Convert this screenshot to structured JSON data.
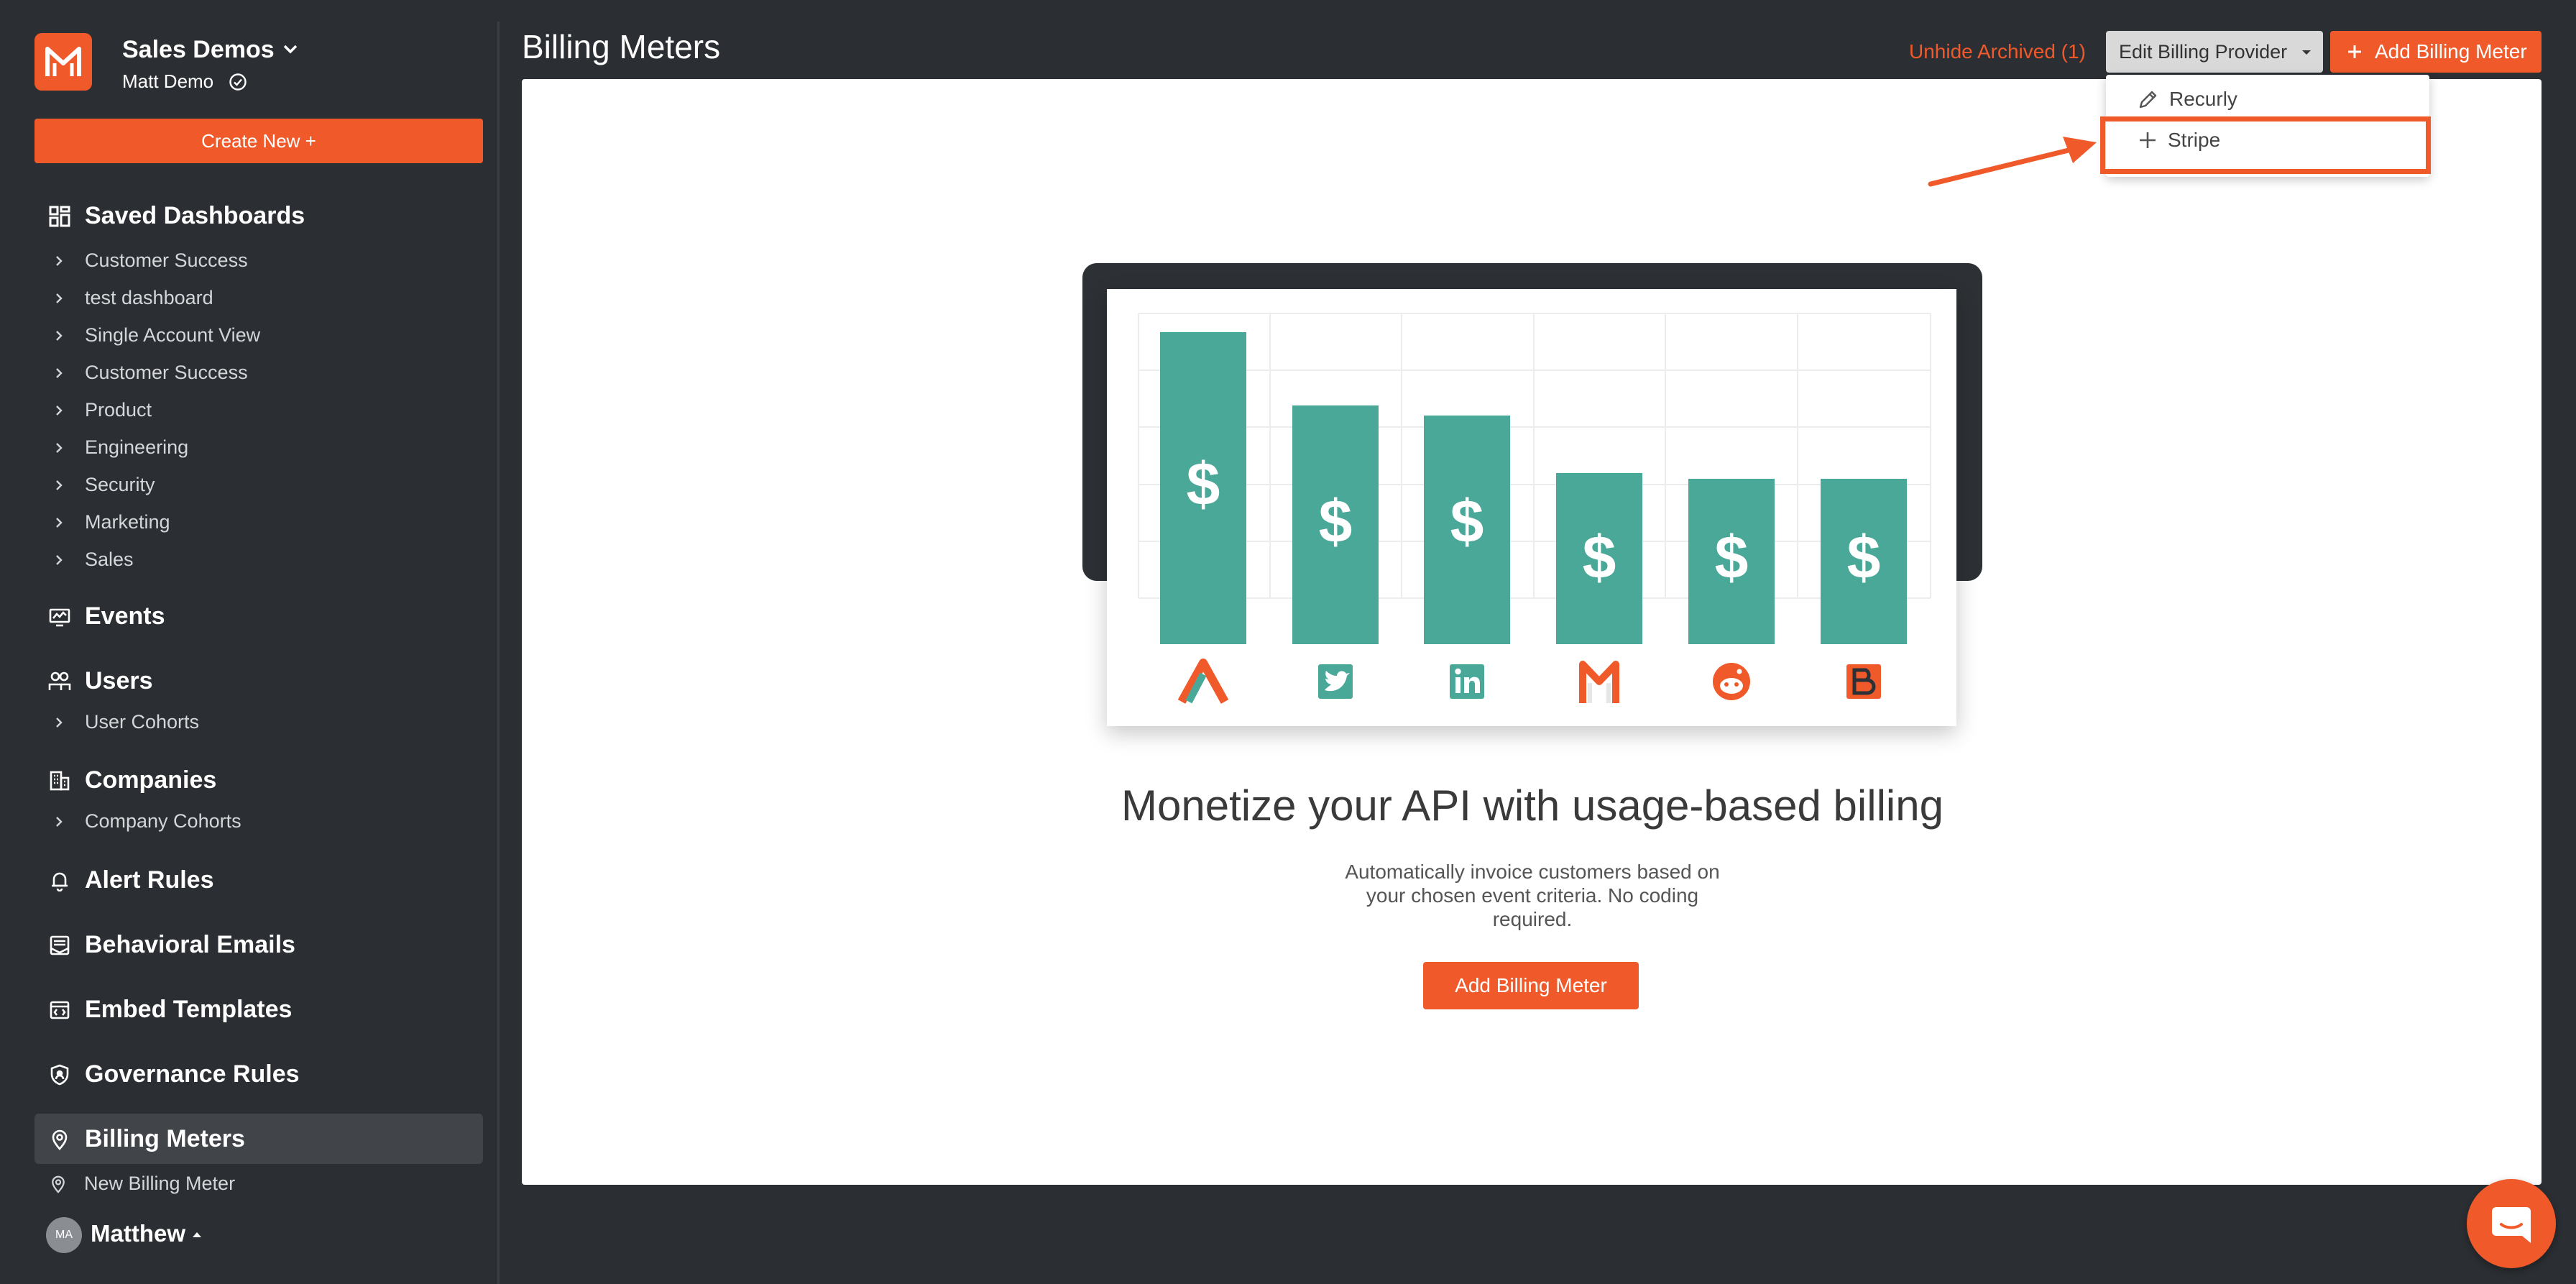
{
  "sidebar": {
    "org_name": "Sales Demos",
    "user_name": "Matt Demo",
    "create_button": "Create New +",
    "saved_dashboards": {
      "label": "Saved Dashboards",
      "items": [
        "Customer Success",
        "test dashboard",
        "Single Account View",
        "Customer Success",
        "Product",
        "Engineering",
        "Security",
        "Marketing",
        "Sales"
      ]
    },
    "events": "Events",
    "users": {
      "label": "Users",
      "items": [
        "User Cohorts"
      ]
    },
    "companies": {
      "label": "Companies",
      "items": [
        "Company Cohorts"
      ]
    },
    "alert_rules": "Alert Rules",
    "behavioral_emails": "Behavioral Emails",
    "embed_templates": "Embed Templates",
    "governance_rules": "Governance Rules",
    "billing_meters": "Billing Meters",
    "new_billing_meter": "New Billing Meter",
    "account": {
      "initials": "MA",
      "name": "Matthew"
    }
  },
  "header": {
    "title": "Billing Meters",
    "unhide_archived": "Unhide Archived (1)",
    "edit_provider": "Edit Billing Provider",
    "add_meter": "Add Billing Meter"
  },
  "dropdown": {
    "items": [
      {
        "label": "Recurly",
        "icon": "pencil-icon"
      },
      {
        "label": "Stripe",
        "icon": "plus-icon",
        "highlighted": true
      }
    ]
  },
  "empty_state": {
    "headline": "Monetize your API with usage-based billing",
    "description": "Automatically invoice customers based on your chosen event criteria. No coding required.",
    "button": "Add Billing Meter",
    "chart_icons": [
      "amplitude-icon",
      "twitter-icon",
      "linkedin-icon",
      "gmail-icon",
      "reddit-icon",
      "blogger-icon"
    ],
    "bar_symbol": "$"
  },
  "colors": {
    "accent": "#f05a2a",
    "bar": "#4aa899",
    "sidebar": "#2b2e32"
  }
}
